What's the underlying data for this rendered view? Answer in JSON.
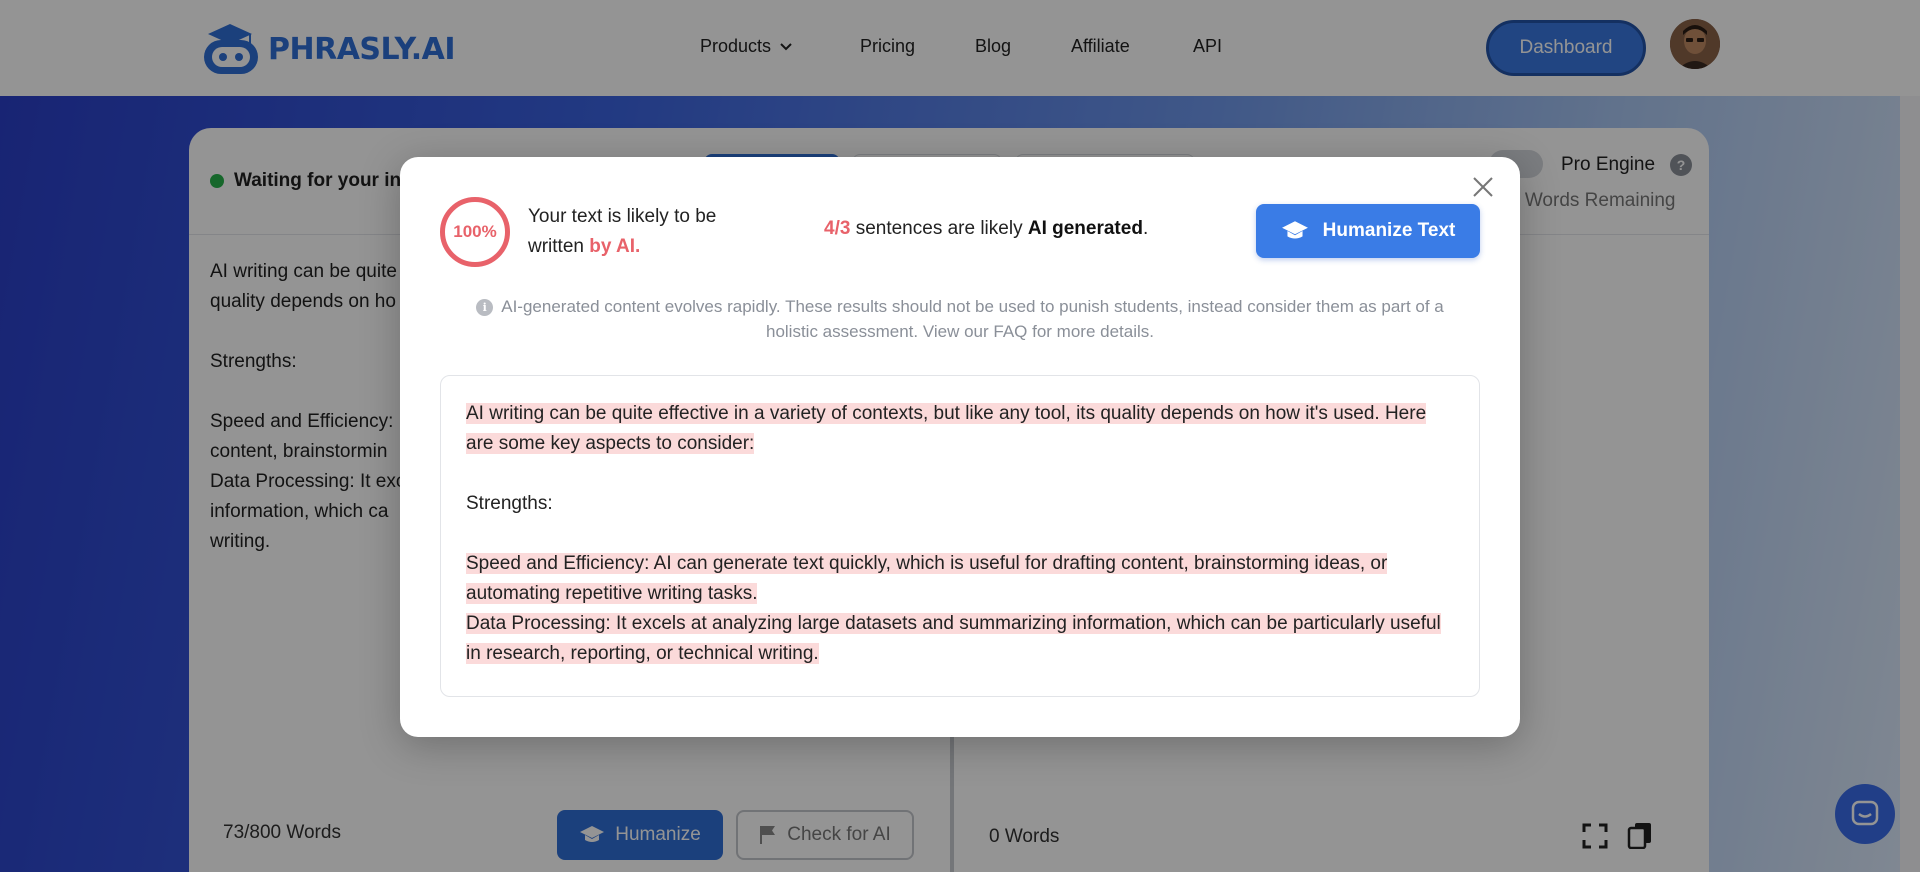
{
  "header": {
    "logo_text": "PHRASLY.AI",
    "nav": {
      "products": "Products",
      "pricing": "Pricing",
      "blog": "Blog",
      "affiliate": "Affiliate",
      "api": "API"
    },
    "dashboard_label": "Dashboard"
  },
  "card": {
    "status_text": "Waiting for your in",
    "pro_engine_label": "Pro Engine",
    "help_glyph": "?",
    "words_remaining": "0 Words Remaining",
    "left_text": "AI writing can be quite\nquality depends on ho\n\nStrengths:\n\nSpeed and Efficiency:\ncontent, brainstormin\nData Processing: It exc\ninformation, which ca\nwriting.",
    "word_count_current": "73",
    "word_count_limit": "/800 Words",
    "humanize_label": "Humanize",
    "check_label": "Check for AI",
    "right_word_count": "0 Words"
  },
  "modal": {
    "score": "100%",
    "likely_prefix": "Your text is likely to be written ",
    "likely_highlight": "by AI.",
    "sentence_count": "4/3",
    "sentence_middle": " sentences are likely ",
    "sentence_ai": "AI generated",
    "sentence_end": ".",
    "humanize_text_label": "Humanize Text",
    "info_glyph": "i",
    "disclaimer": "AI-generated content evolves rapidly. These results should not be used to punish students, instead consider them as part of a holistic assessment. View our FAQ for more details.",
    "result": {
      "p1": "AI writing can be quite effective in a variety of contexts, but like any tool, its quality depends on how it's used. Here are some key aspects to consider:",
      "p2": "Strengths:",
      "p3": "Speed and Efficiency: AI can generate text quickly, which is useful for drafting content, brainstorming ideas, or automating repetitive writing tasks.",
      "p4": "Data Processing: It excels at analyzing large datasets and summarizing information, which can be particularly useful in research, reporting, or technical writing."
    }
  },
  "colors": {
    "brand_blue": "#2f6fd6",
    "ai_red": "#e8626a",
    "highlight": "#fbdada",
    "status_green": "#27b24a"
  },
  "icons": [
    "robot-logo-icon",
    "chevron-down-icon",
    "graduation-cap-icon",
    "flag-icon",
    "expand-icon",
    "copy-icon",
    "close-icon",
    "info-icon",
    "help-icon",
    "chat-icon"
  ]
}
